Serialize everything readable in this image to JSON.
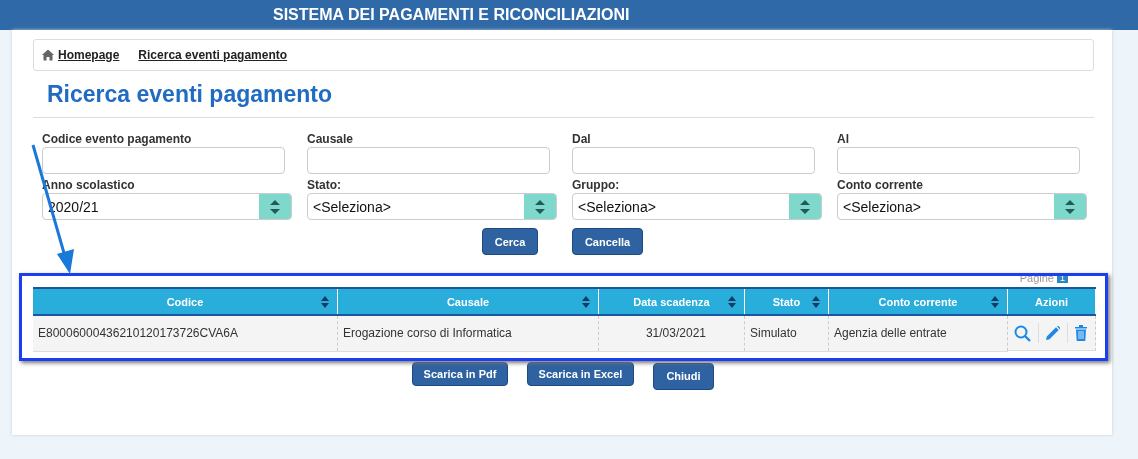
{
  "header": {
    "title": "SISTEMA DEI PAGAMENTI E RICONCILIAZIONI"
  },
  "breadcrumb": [
    "Homepage",
    "Ricerca eventi pagamento"
  ],
  "page_title": "Ricerca eventi pagamento",
  "filters": [
    {
      "kind": "input",
      "label": "Codice evento pagamento"
    },
    {
      "kind": "input",
      "label": "Causale"
    },
    {
      "kind": "input",
      "label": "Dal"
    },
    {
      "kind": "input",
      "label": "Al"
    },
    {
      "kind": "select",
      "label": "Anno scolastico",
      "value": "2020/21"
    },
    {
      "kind": "select",
      "label": "Stato:",
      "value": "<Seleziona>"
    },
    {
      "kind": "select",
      "label": "Gruppo:",
      "value": "<Seleziona>"
    },
    {
      "kind": "select",
      "label": "Conto corrente",
      "value": "<Seleziona>"
    }
  ],
  "form_buttons": [
    "Cerca",
    "Cancella"
  ],
  "pager": {
    "label": "Pagine",
    "page": "1"
  },
  "table": {
    "columns": [
      {
        "label": "Codice",
        "sortable": true
      },
      {
        "label": "Causale",
        "sortable": true
      },
      {
        "label": "Data scadenza",
        "sortable": true
      },
      {
        "label": "Stato",
        "sortable": true
      },
      {
        "label": "Conto corrente",
        "sortable": true
      },
      {
        "label": "Azioni",
        "sortable": false
      }
    ],
    "rows": [
      {
        "cells": [
          "E80006000436210120173726CVA6A",
          "Erogazione corso di Informatica",
          "31/03/2021",
          "Simulato",
          "Agenzia delle entrate"
        ]
      }
    ]
  },
  "bottom_buttons": [
    "Scarica in Pdf",
    "Scarica in Excel",
    "Chiudi"
  ]
}
